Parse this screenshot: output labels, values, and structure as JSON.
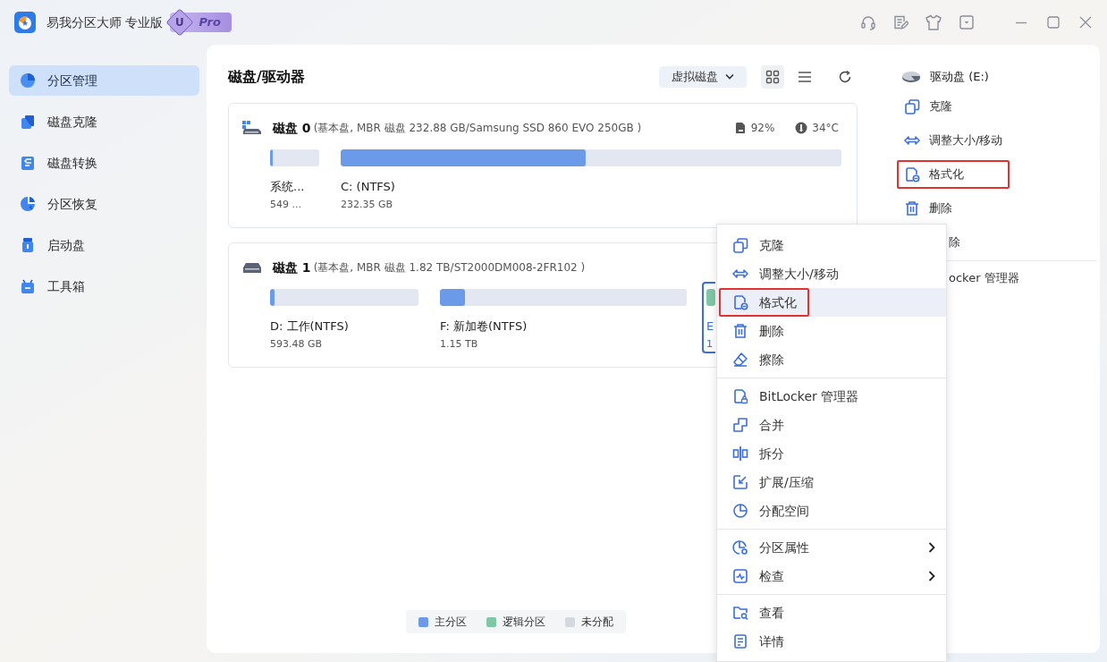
{
  "app": {
    "title": "易我分区大师 专业版",
    "badge_letter": "U",
    "badge": "Pro"
  },
  "sidebar": {
    "items": [
      {
        "label": "分区管理",
        "selected": true
      },
      {
        "label": "磁盘克隆",
        "selected": false
      },
      {
        "label": "磁盘转换",
        "selected": false
      },
      {
        "label": "分区恢复",
        "selected": false
      },
      {
        "label": "启动盘",
        "selected": false
      },
      {
        "label": "工具箱",
        "selected": false
      }
    ]
  },
  "main": {
    "title": "磁盘/驱动器",
    "dropdown": "虚拟磁盘",
    "views": [
      {
        "kind": "grid",
        "selected": true
      },
      {
        "kind": "list",
        "selected": false
      }
    ]
  },
  "disks": [
    {
      "name": "磁盘 0",
      "details": "(基本盘, MBR 磁盘 232.88 GB/Samsung SSD 860 EVO 250GB )",
      "health": "92%",
      "temperature": "34°C",
      "partitions": [
        {
          "label": "系统...",
          "size": "549 ...",
          "color": "#6a9ae8",
          "level": 0.05,
          "selected": false
        },
        {
          "label": "C: (NTFS)",
          "size": "232.35 GB",
          "color": "#6a9ae8",
          "level": 0.49,
          "selected": false
        }
      ]
    },
    {
      "name": "磁盘 1",
      "details": "(基本盘, MBR 磁盘 1.82 TB/ST2000DM008-2FR102 )",
      "partitions": [
        {
          "label": "D: 工作(NTFS)",
          "size": "593.48 GB",
          "color": "#6a9ae8",
          "level": 0.03,
          "selected": false
        },
        {
          "label": "F: 新加卷(NTFS)",
          "size": "1.15 TB",
          "color": "#6a9ae8",
          "level": 0.1,
          "selected": false
        },
        {
          "label": "E",
          "size": "1",
          "color": "#7fc7a5",
          "selected": true
        }
      ]
    }
  ],
  "legend": [
    {
      "label": "主分区",
      "color": "#6a9ae8"
    },
    {
      "label": "逻辑分区",
      "color": "#7fc7a5"
    },
    {
      "label": "未分配",
      "color": "#d5d8de"
    }
  ],
  "side_panel": {
    "drive": "驱动盘 (E:)",
    "actions": [
      {
        "label": "克隆",
        "kind": "clone",
        "highlighted": false
      },
      {
        "label": "调整大小/移动",
        "kind": "resize",
        "highlighted": false
      },
      {
        "label": "格式化",
        "kind": "format",
        "highlighted": true
      },
      {
        "label": "删除",
        "kind": "delete",
        "highlighted": false
      },
      {
        "label": "除",
        "kind": "covered",
        "highlighted": false
      },
      {
        "label": "ocker 管理器",
        "kind": "covered",
        "highlighted": false,
        "divider_before": true
      }
    ]
  },
  "context_menu": {
    "groups": [
      [
        {
          "label": "克隆",
          "kind": "clone",
          "selected": false,
          "highlighted": false
        },
        {
          "label": "调整大小/移动",
          "kind": "resize",
          "selected": false,
          "highlighted": false
        },
        {
          "label": "格式化",
          "kind": "format",
          "selected": true,
          "highlighted": true
        },
        {
          "label": "删除",
          "kind": "delete",
          "selected": false,
          "highlighted": false
        },
        {
          "label": "擦除",
          "kind": "wipe",
          "selected": false,
          "highlighted": false
        }
      ],
      [
        {
          "label": "BitLocker 管理器",
          "kind": "lock",
          "selected": false,
          "highlighted": false
        },
        {
          "label": "合并",
          "kind": "merge",
          "selected": false,
          "highlighted": false
        },
        {
          "label": "拆分",
          "kind": "split",
          "selected": false,
          "highlighted": false
        },
        {
          "label": "扩展/压缩",
          "kind": "extend",
          "selected": false,
          "highlighted": false
        },
        {
          "label": "分配空间",
          "kind": "allocate",
          "selected": false,
          "highlighted": false
        }
      ],
      [
        {
          "label": "分区属性",
          "kind": "properties",
          "selected": false,
          "highlighted": false,
          "submenu": true
        },
        {
          "label": "检查",
          "kind": "check",
          "selected": false,
          "highlighted": false,
          "submenu": true
        }
      ],
      [
        {
          "label": "查看",
          "kind": "explore",
          "selected": false,
          "highlighted": false
        },
        {
          "label": "详情",
          "kind": "details",
          "selected": false,
          "highlighted": false
        }
      ]
    ]
  }
}
